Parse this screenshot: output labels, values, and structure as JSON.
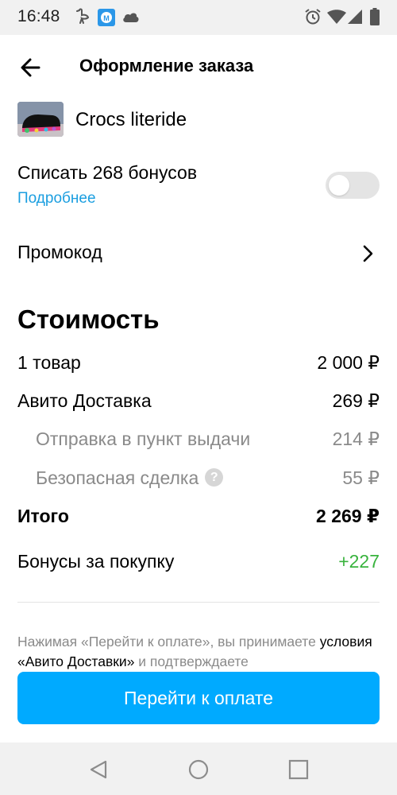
{
  "status_bar": {
    "time": "16:48",
    "left_icons": [
      "ostrich-icon",
      "m-app-icon",
      "cloud-icon"
    ],
    "right_icons": [
      "alarm-icon",
      "wifi-icon",
      "signal-icon",
      "battery-icon"
    ]
  },
  "header": {
    "back_icon": "arrow-left-icon",
    "title": "Оформление заказа"
  },
  "item": {
    "title": "Crocs literide",
    "thumbnail": "crocs-shoe-photo"
  },
  "bonus": {
    "label": "Списать 268 бонусов",
    "more_link": "Подробнее",
    "toggle_on": false
  },
  "promo": {
    "label": "Промокод",
    "chevron_icon": "chevron-right-icon"
  },
  "cost": {
    "heading": "Стоимость",
    "rows": [
      {
        "label": "1 товар",
        "value": "2 000 ₽"
      },
      {
        "label": "Авито Доставка",
        "value": "269 ₽"
      },
      {
        "label": "Отправка в пункт выдачи",
        "value": "214 ₽"
      },
      {
        "label": "Безопасная сделка",
        "value": "55 ₽"
      }
    ],
    "help_icon": "?",
    "total": {
      "label": "Итого",
      "value": "2 269 ₽"
    },
    "bonuses": {
      "label": "Бонусы за покупку",
      "value": "+227"
    }
  },
  "terms": {
    "part1": "Нажимая «Перейти к оплате», вы принимаете",
    "link": "условия «Авито Доставки»",
    "part2": " и подтверждаете"
  },
  "pay_button": {
    "label": "Перейти к оплате",
    "color": "#00aaff"
  },
  "colors": {
    "accent_link": "#1a9ee0",
    "bonus_green": "#39b33e",
    "muted_text": "#8a8a8a"
  },
  "nav_bar": {
    "icons": [
      "back-triangle-icon",
      "home-circle-icon",
      "recents-square-icon"
    ]
  }
}
